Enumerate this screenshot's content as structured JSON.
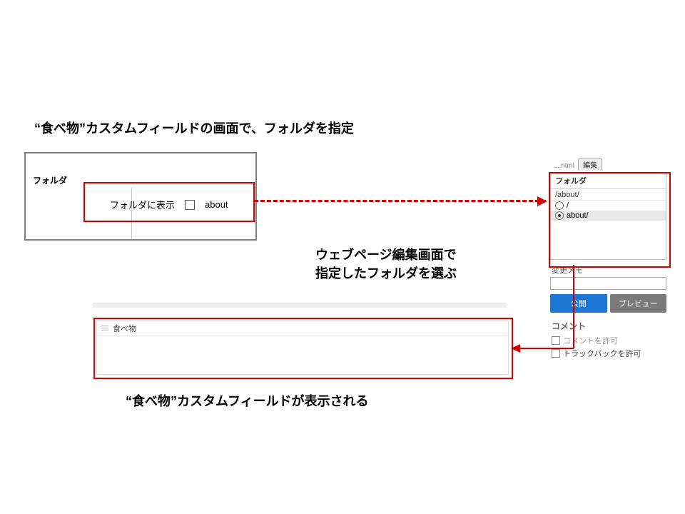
{
  "titles": {
    "t1": "“食べ物”カスタムフィールドの画面で、フォルダを指定",
    "t2_line1": "ウェブページ編集画面で",
    "t2_line2": "指定したフォルダを選ぶ",
    "t3": "“食べ物”カスタムフィールドが表示される"
  },
  "left_panel": {
    "folder_label": "フォルダ",
    "display_in_folder_label": "フォルダに表示",
    "checkbox_label": "about"
  },
  "right_sidebar": {
    "tab_hint": "....ntml",
    "tab_edit": "編集",
    "folder_header": "フォルダ",
    "folder_path": "/about/",
    "folder_options": {
      "root": "/",
      "about": "about/"
    },
    "memo_label": "変更メモ",
    "btn_publish": "公開",
    "btn_preview": "プレビュー",
    "comment_header": "コメント",
    "allow_comment": "コメントを許可",
    "allow_trackback": "トラックバックを許可"
  },
  "food_field": {
    "title": "食べ物"
  }
}
